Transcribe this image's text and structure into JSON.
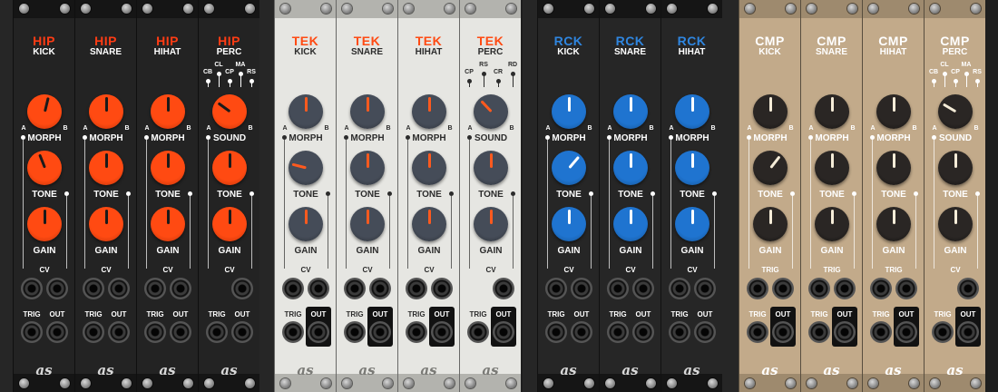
{
  "groups": [
    {
      "brand": "HIP",
      "theme": {
        "bg": "#232323",
        "rail": "#151515",
        "brand": "#ff3c14",
        "text": "#ffffff",
        "knob": "#ff4a12",
        "knob_ring": "#b83008",
        "ptr": "#1a1a1a",
        "logo": "#d9d9d9"
      },
      "modules": [
        {
          "voice": "KICK",
          "top_label": "MORPH",
          "out_boxed": false,
          "knob_values": [
            0.55,
            0.42,
            0.5
          ],
          "cv_jacks": 2
        },
        {
          "voice": "SNARE",
          "top_label": "MORPH",
          "out_boxed": false,
          "knob_values": [
            0.5,
            0.5,
            0.5
          ],
          "cv_jacks": 2
        },
        {
          "voice": "HIHAT",
          "top_label": "MORPH",
          "out_boxed": false,
          "knob_values": [
            0.5,
            0.5,
            0.5
          ],
          "cv_jacks": 2
        },
        {
          "voice": "PERC",
          "top_label": "SOUND",
          "out_boxed": false,
          "knob_values": [
            0.3,
            0.5,
            0.5
          ],
          "cv_jacks": 1,
          "switch": [
            "CB",
            "CL",
            "CP",
            "MA",
            "RS"
          ]
        }
      ]
    },
    {
      "brand": "TEK",
      "theme": {
        "bg": "#e6e6e2",
        "rail": "#b3b3ae",
        "brand": "#ff4a12",
        "text": "#2c2c2c",
        "knob": "#454c58",
        "knob_ring": "#2b2f36",
        "ptr": "#ff5a1e",
        "logo": "#7a7a76"
      },
      "modules": [
        {
          "voice": "KICK",
          "top_label": "MORPH",
          "out_boxed": true,
          "knob_values": [
            0.5,
            0.22,
            0.5
          ],
          "cv_jacks": 2
        },
        {
          "voice": "SNARE",
          "top_label": "MORPH",
          "out_boxed": true,
          "knob_values": [
            0.5,
            0.5,
            0.5
          ],
          "cv_jacks": 2
        },
        {
          "voice": "HIHAT",
          "top_label": "MORPH",
          "out_boxed": true,
          "knob_values": [
            0.5,
            0.5,
            0.5
          ],
          "cv_jacks": 2
        },
        {
          "voice": "PERC",
          "top_label": "SOUND",
          "out_boxed": true,
          "knob_values": [
            0.34,
            0.5,
            0.5
          ],
          "cv_jacks": 1,
          "switch": [
            "CP",
            "RS",
            "CR",
            "RD"
          ]
        }
      ]
    },
    {
      "brand": "RCK",
      "theme": {
        "bg": "#262626",
        "rail": "#151515",
        "brand": "#2f86e0",
        "text": "#ffffff",
        "knob": "#1f74d0",
        "knob_ring": "#14508e",
        "ptr": "#ffffff",
        "logo": "#d9d9d9"
      },
      "modules": [
        {
          "voice": "KICK",
          "top_label": "MORPH",
          "out_boxed": false,
          "knob_values": [
            0.5,
            0.65,
            0.5
          ],
          "cv_jacks": 2
        },
        {
          "voice": "SNARE",
          "top_label": "MORPH",
          "out_boxed": false,
          "knob_values": [
            0.5,
            0.5,
            0.5
          ],
          "cv_jacks": 2
        },
        {
          "voice": "HIHAT",
          "top_label": "MORPH",
          "out_boxed": false,
          "knob_values": [
            0.5,
            0.5,
            0.5
          ],
          "cv_jacks": 2
        }
      ]
    },
    {
      "brand": "CMP",
      "theme": {
        "bg": "#c2aa8a",
        "rail": "#9e8a6e",
        "brand": "#ffffff",
        "text": "#ffffff",
        "knob": "#2a2624",
        "knob_ring": "#141210",
        "ptr": "#f5ecd8",
        "logo": "#ffffff"
      },
      "modules": [
        {
          "voice": "KICK",
          "top_label": "MORPH",
          "out_boxed": true,
          "knob_values": [
            0.5,
            0.64,
            0.5
          ],
          "cv_jacks": 2,
          "bottom_cv_label": "TRIG"
        },
        {
          "voice": "SNARE",
          "top_label": "MORPH",
          "out_boxed": true,
          "knob_values": [
            0.5,
            0.5,
            0.5
          ],
          "cv_jacks": 2,
          "bottom_cv_label": "TRIG"
        },
        {
          "voice": "HIHAT",
          "top_label": "MORPH",
          "out_boxed": true,
          "knob_values": [
            0.5,
            0.5,
            0.5
          ],
          "cv_jacks": 2,
          "bottom_cv_label": "TRIG"
        },
        {
          "voice": "PERC",
          "top_label": "SOUND",
          "out_boxed": true,
          "knob_values": [
            0.28,
            0.5,
            0.5
          ],
          "cv_jacks": 1,
          "bottom_cv_label": "CV",
          "switch": [
            "CB",
            "CL",
            "CP",
            "MA",
            "RS"
          ]
        }
      ]
    }
  ],
  "labels": {
    "tone": "TONE",
    "gain": "GAIN",
    "cv": "CV",
    "trig": "TRIG",
    "out": "OUT",
    "a": "A",
    "b": "B",
    "logo": "as"
  }
}
